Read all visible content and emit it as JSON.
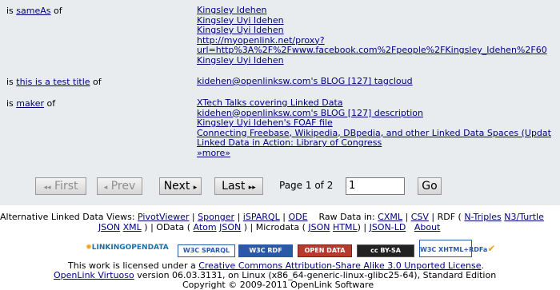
{
  "relations": [
    {
      "prefix": "is ",
      "link": "sameAs",
      "suffix": " of",
      "values": [
        "Kingsley Idehen",
        "Kingsley Uyi Idehen",
        "Kingsley Uyi Idehen",
        "http://myopenlink.net/proxy?",
        "url=http%3A%2F%2Fwww.facebook.com%2Fpeople%2FKingsley_Idehen%2F60",
        "Kingsley Uyi Idehen"
      ]
    },
    {
      "prefix": "is ",
      "link": "this is a test title",
      "suffix": " of",
      "values": [
        "kidehen@openlinksw.com's BLOG [127] tagcloud"
      ]
    },
    {
      "prefix": "is ",
      "link": "maker",
      "suffix": " of",
      "values": [
        "XTech Talks covering Linked Data",
        "kidehen@openlinksw.com's BLOG [127] description",
        "Kingsley Uyi Idehen's FOAF file",
        "Connecting Freebase, Wikipedia, DBpedia, and other Linked Data Spaces (Updat",
        "Linked Data in Action: Library of Congress",
        "»more»"
      ]
    }
  ],
  "pager": {
    "first": "First",
    "prev": "Prev",
    "next": "Next",
    "last": "Last",
    "page_text": "Page 1 of 2",
    "page_input": "1",
    "go": "Go"
  },
  "footer": {
    "alt_label": "Alternative Linked Data Views: ",
    "pivot": "PivotViewer",
    "sponger": "Sponger",
    "isparql": "iSPARQL",
    "ode": "ODE",
    "raw_label": "Raw Data in: ",
    "cxml": "CXML",
    "csv": "CSV",
    "rdf_label": "RDF (",
    "ntriples": "N-Triples",
    "n3": "N3/Turtle",
    "json": "JSON",
    "xml": "XML",
    "odata_label": "OData (",
    "atom": "Atom",
    "json2": "JSON",
    "microdata_label": "Microdata (",
    "json3": "JSON",
    "html": "HTML",
    "jsonld": "JSON-LD",
    "about": "About",
    "license_pre": "This work is licensed under a ",
    "license_link": "Creative Commons Attribution-Share Alike 3.0 Unported License",
    "license_post": ".",
    "virtuoso": "OpenLink Virtuoso",
    "version": " version 06.03.3131, on Linux (x86_64-generic-linux-glibc25-64), Standard Edition",
    "copyright": "Copyright © 2009-2011 OpenLink Software"
  },
  "badges": {
    "lod": "LINKINGOPENDATA",
    "w3c_sparql": "W3C SPARQL",
    "w3c_rdf": "W3C RDF",
    "opendata": "OPEN DATA",
    "ccbysa": "cc BY-SA",
    "w3c_xhtml": "W3C XHTML+RDFa"
  },
  "colors": {
    "panel_bg": "#e9ecef",
    "link": "#00007f"
  }
}
